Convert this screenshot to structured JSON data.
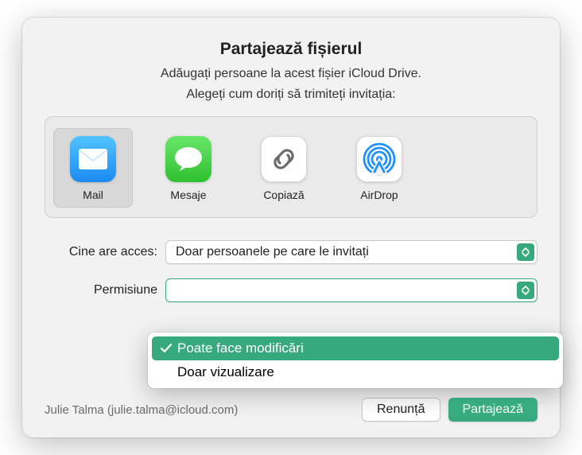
{
  "title": "Partajează fișierul",
  "subtitle": "Adăugați persoane la acest fișier iCloud Drive.",
  "instruction": "Alegeți cum doriți să trimiteți invitația:",
  "apps": [
    {
      "label": "Mail",
      "icon": "mail-icon",
      "selected": true
    },
    {
      "label": "Mesaje",
      "icon": "messages-icon",
      "selected": false
    },
    {
      "label": "Copiază",
      "icon": "link-icon",
      "selected": false
    },
    {
      "label": "AirDrop",
      "icon": "airdrop-icon",
      "selected": false
    }
  ],
  "access": {
    "label": "Cine are acces:",
    "value": "Doar persoanele pe care le invitați"
  },
  "permission": {
    "label": "Permisiune",
    "options": [
      {
        "label": "Poate face modificări",
        "selected": true
      },
      {
        "label": "Doar vizualizare",
        "selected": false
      }
    ]
  },
  "user": "Julie Talma (julie.talma@icloud.com)",
  "buttons": {
    "cancel": "Renunță",
    "share": "Partajează"
  }
}
